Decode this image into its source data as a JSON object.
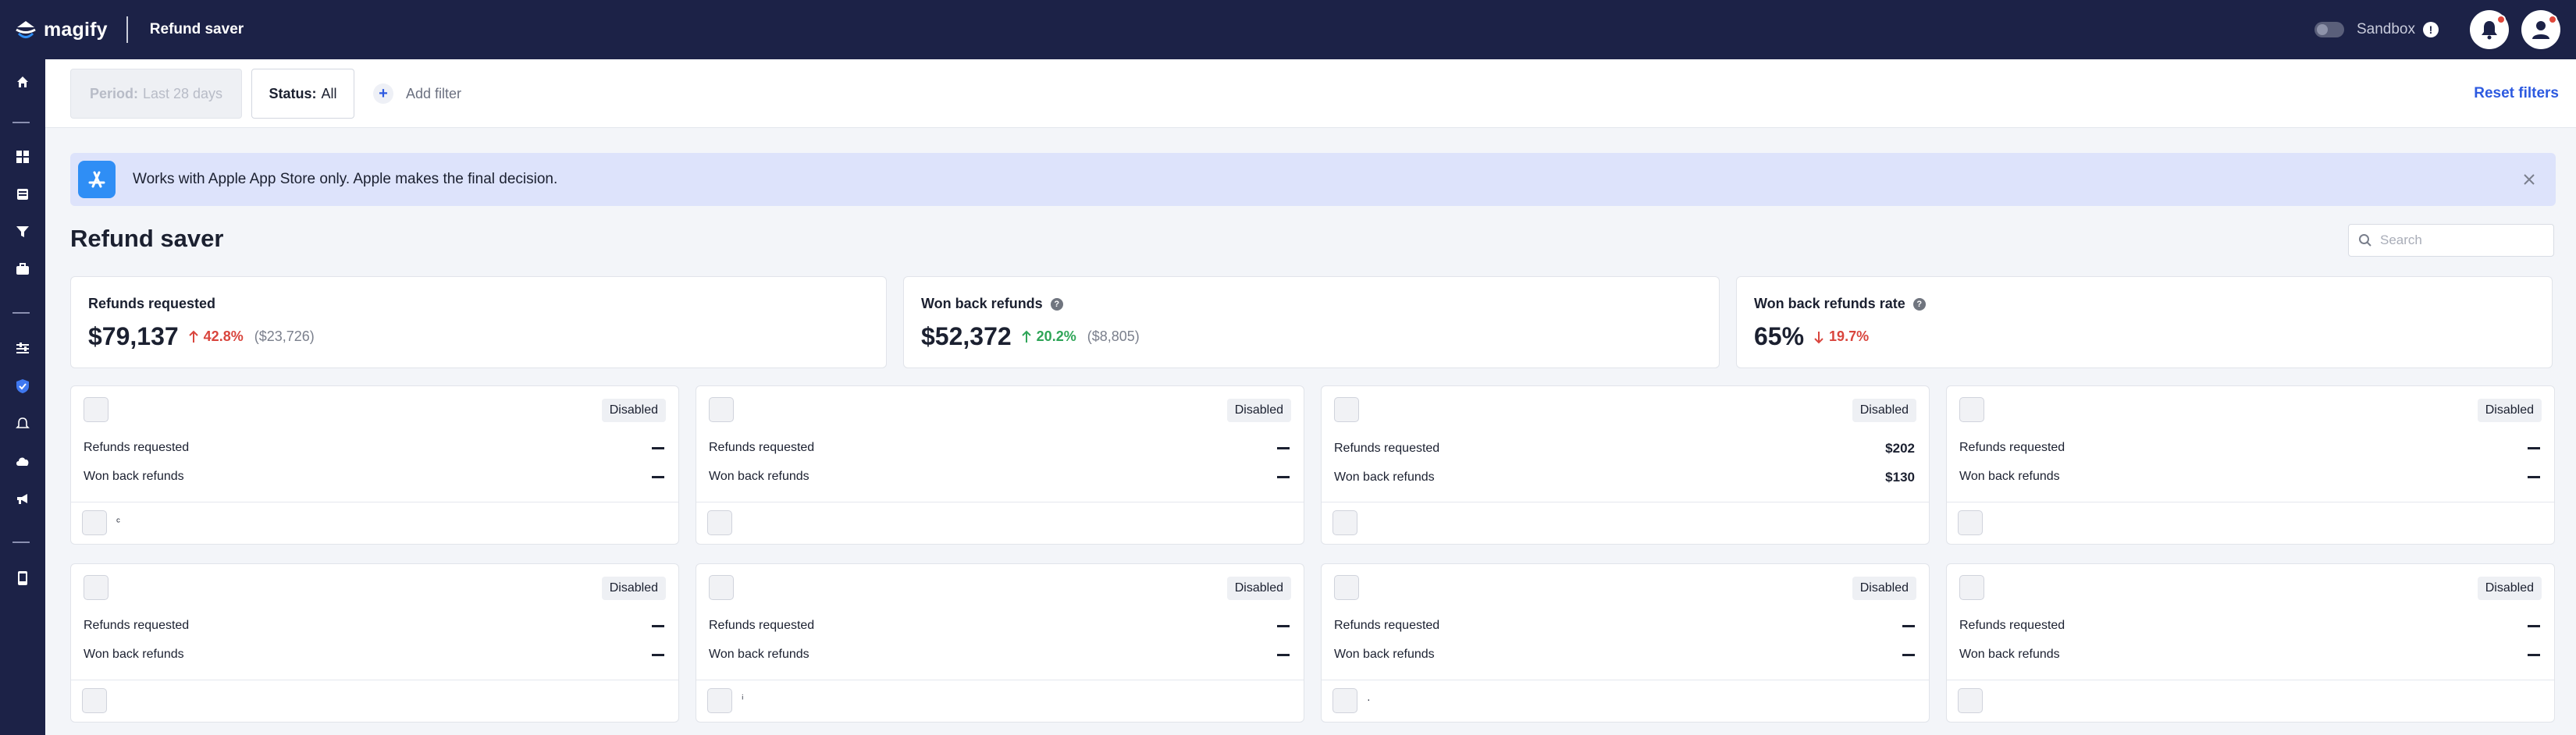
{
  "topbar": {
    "brand": "magify",
    "section_title": "Refund saver",
    "sandbox_label": "Sandbox",
    "sandbox_info": "!",
    "sandbox_enabled": false
  },
  "sidebar": {
    "items": [
      "home-icon",
      "dashboard-icon",
      "inbox-icon",
      "funnel-icon",
      "briefcase-icon",
      "sliders-icon",
      "shield-icon",
      "bell-icon",
      "cloud-icon",
      "megaphone-icon",
      "phone-icon"
    ],
    "active": "shield-icon"
  },
  "filters": {
    "period_key": "Period:",
    "period_value": "Last 28 days",
    "status_key": "Status:",
    "status_value": "All",
    "add_filter": "Add filter",
    "add_filter_icon": "+",
    "reset": "Reset filters"
  },
  "banner": {
    "text": "Works with Apple App Store only. Apple makes the final decision."
  },
  "page": {
    "title": "Refund saver",
    "search_placeholder": "Search"
  },
  "metrics": [
    {
      "label": "Refunds requested",
      "value": "$79,137",
      "delta": "42.8%",
      "delta_direction": "up",
      "delta_color": "#d9453d",
      "previous": "($23,726)",
      "help": false
    },
    {
      "label": "Won back refunds",
      "value": "$52,372",
      "delta": "20.2%",
      "delta_direction": "up",
      "delta_color": "#2fa558",
      "previous": "($8,805)",
      "help": true
    },
    {
      "label": "Won back refunds rate",
      "value": "65%",
      "delta": "19.7%",
      "delta_direction": "down",
      "delta_color": "#d9453d",
      "previous": "",
      "help": true
    }
  ],
  "help_glyph": "?",
  "card_labels": {
    "status": "Disabled",
    "refunds_requested": "Refunds requested",
    "won_back_refunds": "Won back refunds"
  },
  "cards": [
    {
      "refunds_requested": "",
      "won_back_refunds": "",
      "foot_name": "ᶜ"
    },
    {
      "refunds_requested": "",
      "won_back_refunds": "",
      "foot_name": ""
    },
    {
      "refunds_requested": "$202",
      "won_back_refunds": "$130",
      "foot_name": ""
    },
    {
      "refunds_requested": "",
      "won_back_refunds": "",
      "foot_name": ""
    },
    {
      "refunds_requested": "",
      "won_back_refunds": "",
      "foot_name": ""
    },
    {
      "refunds_requested": "",
      "won_back_refunds": "",
      "foot_name": "ⁱ"
    },
    {
      "refunds_requested": "",
      "won_back_refunds": "",
      "foot_name": "·"
    },
    {
      "refunds_requested": "",
      "won_back_refunds": "",
      "foot_name": ""
    }
  ]
}
